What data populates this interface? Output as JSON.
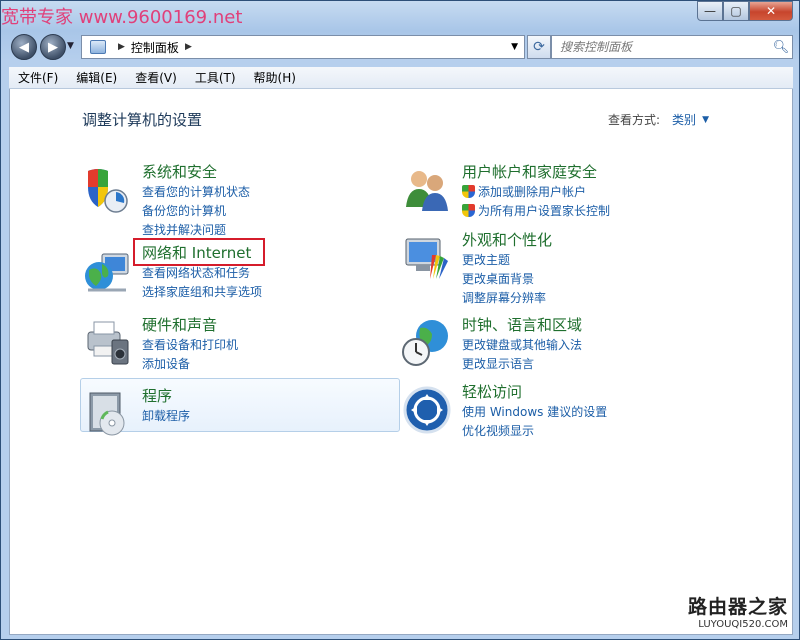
{
  "watermark": "宽带专家 www.9600169.net",
  "window_controls": {
    "minimize": "—",
    "maximize": "▢",
    "close": "✕"
  },
  "address": {
    "location": "控制面板",
    "back_icon": "back-arrow-icon",
    "forward_icon": "forward-arrow-icon"
  },
  "search": {
    "placeholder": "搜索控制面板"
  },
  "menu": [
    "文件(F)",
    "编辑(E)",
    "查看(V)",
    "工具(T)",
    "帮助(H)"
  ],
  "page_title": "调整计算机的设置",
  "view_by": {
    "label": "查看方式:",
    "value": "类别"
  },
  "categories": [
    {
      "title": "系统和安全",
      "icon": "system-security-icon",
      "links": [
        {
          "text": "查看您的计算机状态"
        },
        {
          "text": "备份您的计算机"
        },
        {
          "text": "查找并解决问题"
        }
      ]
    },
    {
      "title": "网络和 Internet",
      "icon": "network-globe-icon",
      "links": [
        {
          "text": "查看网络状态和任务"
        },
        {
          "text": "选择家庭组和共享选项"
        }
      ]
    },
    {
      "title": "硬件和声音",
      "icon": "printer-speaker-icon",
      "links": [
        {
          "text": "查看设备和打印机"
        },
        {
          "text": "添加设备"
        }
      ]
    },
    {
      "title": "程序",
      "icon": "programs-disc-icon",
      "links": [
        {
          "text": "卸载程序"
        }
      ]
    },
    {
      "title": "用户帐户和家庭安全",
      "icon": "users-icon",
      "links": [
        {
          "text": "添加或删除用户帐户",
          "shield": true
        },
        {
          "text": "为所有用户设置家长控制",
          "shield": true
        }
      ]
    },
    {
      "title": "外观和个性化",
      "icon": "appearance-monitor-icon",
      "links": [
        {
          "text": "更改主题"
        },
        {
          "text": "更改桌面背景"
        },
        {
          "text": "调整屏幕分辨率"
        }
      ]
    },
    {
      "title": "时钟、语言和区域",
      "icon": "clock-globe-icon",
      "links": [
        {
          "text": "更改键盘或其他输入法"
        },
        {
          "text": "更改显示语言"
        }
      ]
    },
    {
      "title": "轻松访问",
      "icon": "ease-of-access-icon",
      "links": [
        {
          "text": "使用 Windows 建议的设置"
        },
        {
          "text": "优化视频显示"
        }
      ]
    }
  ],
  "logo": {
    "name": "路由器之家",
    "url": "LUYOUQI520.COM"
  }
}
